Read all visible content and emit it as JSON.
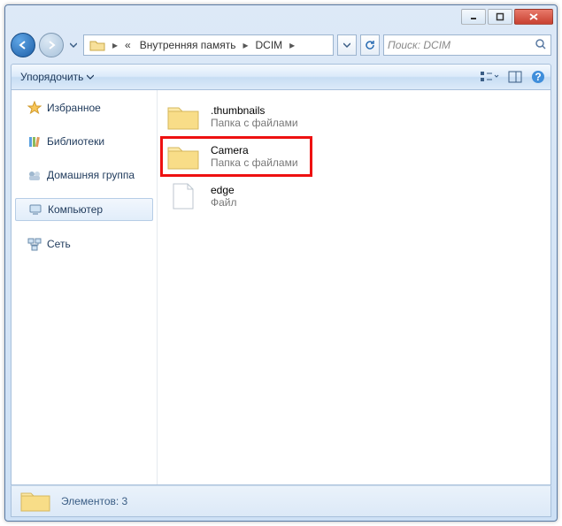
{
  "titlebar": {},
  "breadcrumb": {
    "prefix": "«",
    "seg1": "Внутренняя память",
    "seg2": "DCIM"
  },
  "search": {
    "placeholder": "Поиск: DCIM"
  },
  "toolbar": {
    "organize": "Упорядочить"
  },
  "sidebar": {
    "favorites": "Избранное",
    "libraries": "Библиотеки",
    "homegroup": "Домашняя группа",
    "computer": "Компьютер",
    "network": "Сеть"
  },
  "content": {
    "items": [
      {
        "name": ".thumbnails",
        "sub": "Папка с файлами",
        "type": "folder"
      },
      {
        "name": "Camera",
        "sub": "Папка с файлами",
        "type": "folder",
        "highlight": true
      },
      {
        "name": "edge",
        "sub": "Файл",
        "type": "file"
      }
    ]
  },
  "status": {
    "text": "Элементов: 3"
  }
}
